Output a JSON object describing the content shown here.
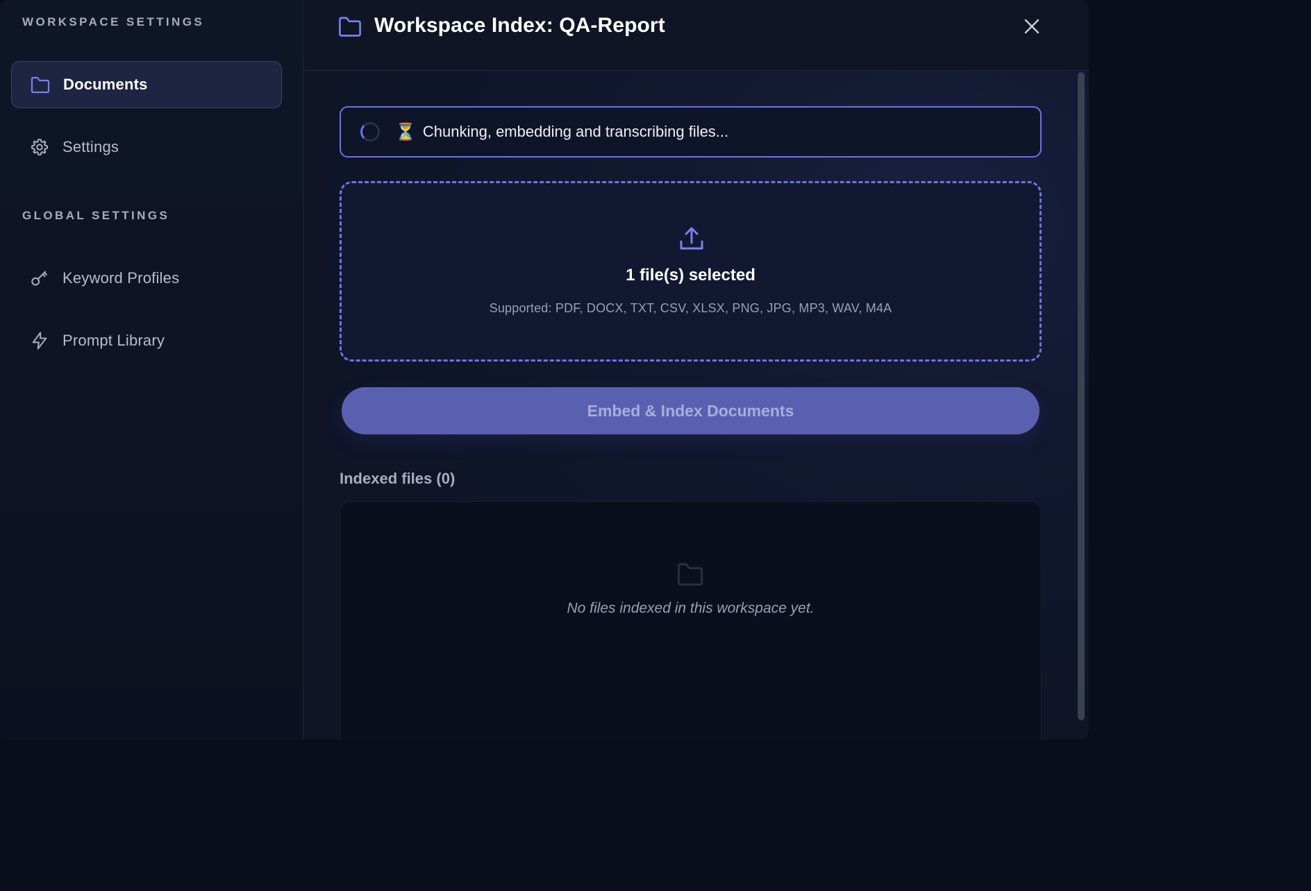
{
  "sidebar": {
    "workspace_heading": "WORKSPACE SETTINGS",
    "global_heading": "GLOBAL SETTINGS",
    "items": [
      {
        "label": "Documents",
        "icon": "folder-icon",
        "active": true
      },
      {
        "label": "Settings",
        "icon": "gear-icon",
        "active": false
      },
      {
        "label": "Keyword Profiles",
        "icon": "key-icon",
        "active": false
      },
      {
        "label": "Prompt Library",
        "icon": "lightning-icon",
        "active": false
      }
    ]
  },
  "header": {
    "title": "Workspace Index: QA-Report",
    "icon": "folder-icon",
    "close_icon": "close-icon"
  },
  "status": {
    "emoji": "⏳",
    "text": "Chunking, embedding and transcribing files..."
  },
  "dropzone": {
    "selected_text": "1 file(s) selected",
    "supported_text": "Supported: PDF, DOCX, TXT, CSV, XLSX, PNG, JPG, MP3, WAV, M4A"
  },
  "embed_button": {
    "label": "Embed & Index Documents"
  },
  "indexed": {
    "label": "Indexed files (0)",
    "empty_text": "No files indexed in this workspace yet."
  },
  "colors": {
    "accent": "#6d72e8",
    "button_bg": "#5a60b0",
    "background": "#0f1525"
  }
}
